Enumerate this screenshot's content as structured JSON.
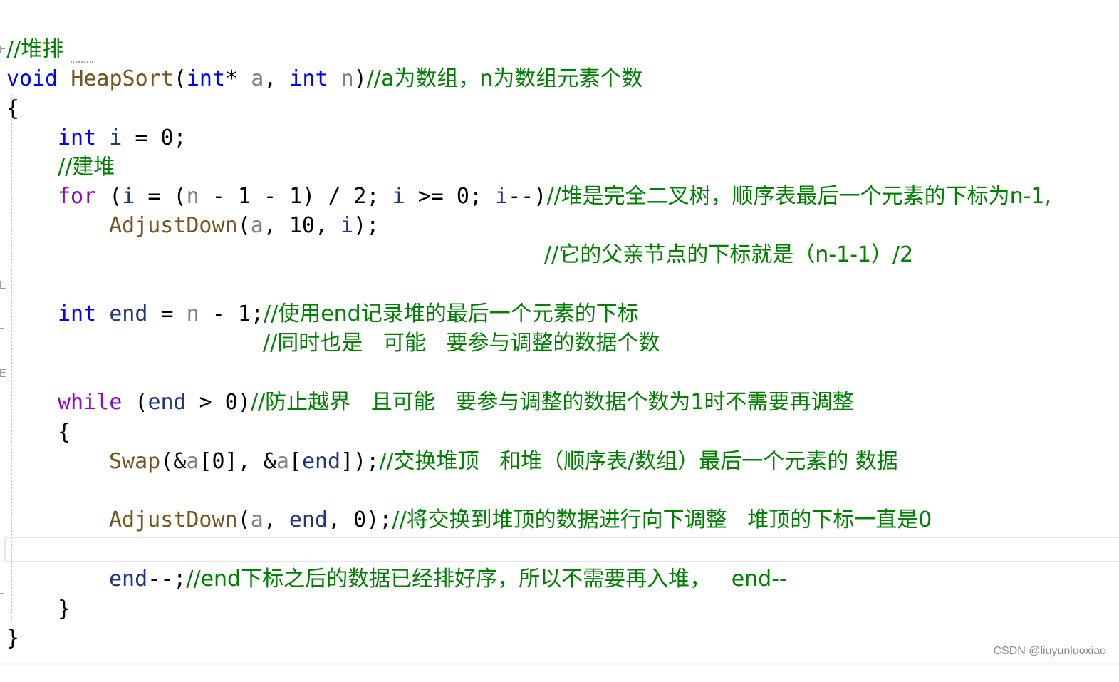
{
  "editor": {
    "language": "C",
    "lines": {
      "l01_comment": "//堆排",
      "l02_void": "void",
      "l02_fn": "HeapSort",
      "l02_open": "(",
      "l02_int1": "int",
      "l02_star": "* ",
      "l02_a": "a",
      "l02_comma": ", ",
      "l02_int2": "int",
      "l02_n": "n",
      "l02_close": ")",
      "l02_comment": "//a为数组，n为数组元素个数",
      "l03_brace": "{",
      "l04_int": "int",
      "l04_i": "i",
      "l04_rest": " = 0;",
      "l05_comment": "//建堆",
      "l06_for": "for",
      "l06_p1": " (",
      "l06_i1": "i",
      "l06_p2": " = (",
      "l06_n": "n",
      "l06_p3": " - 1 - 1) / 2; ",
      "l06_i2": "i",
      "l06_p4": " >= 0; ",
      "l06_i3": "i",
      "l06_p5": "--)",
      "l06_comment": "//堆是完全二叉树，顺序表最后一个元素的下标为n-1,",
      "l07_fn": "AdjustDown",
      "l07_p1": "(",
      "l07_a": "a",
      "l07_p2": ", 10, ",
      "l07_i": "i",
      "l07_p3": ");",
      "l07_comment": "//它的父亲节点的下标就是（n-1-1）/2",
      "l10_int": "int",
      "l10_end": "end",
      "l10_p1": " = ",
      "l10_n": "n",
      "l10_p2": " - 1;",
      "l10_comment": "//使用end记录堆的最后一个元素的下标",
      "l11_comment": "//同时也是   可能   要参与调整的数据个数",
      "l13_while": "while",
      "l13_p1": " (",
      "l13_end": "end",
      "l13_p2": " > 0)",
      "l13_comment": "//防止越界   且可能   要参与调整的数据个数为1时不需要再调整",
      "l14_brace": "{",
      "l15_fn": "Swap",
      "l15_p1": "(&",
      "l15_a1": "a",
      "l15_p2": "[0], &",
      "l15_a2": "a",
      "l15_p3": "[",
      "l15_end": "end",
      "l15_p4": "]);",
      "l15_comment": "//交换堆顶   和堆（顺序表/数组）最后一个元素的 数据",
      "l17_fn": "AdjustDown",
      "l17_p1": "(",
      "l17_a": "a",
      "l17_p2": ", ",
      "l17_end": "end",
      "l17_p3": ", 0);",
      "l17_comment": "//将交换到堆顶的数据进行向下调整   堆顶的下标一直是0",
      "l19_end": "end",
      "l19_p1": "--;",
      "l19_comment": "//end下标之后的数据已经排好序，所以不需要再入堆，   end--",
      "l20_brace": "}",
      "l21_brace": "}"
    }
  },
  "fold_markers": {
    "collapse_glyph": "−"
  },
  "watermark": "CSDN @liuyunluoxiao"
}
